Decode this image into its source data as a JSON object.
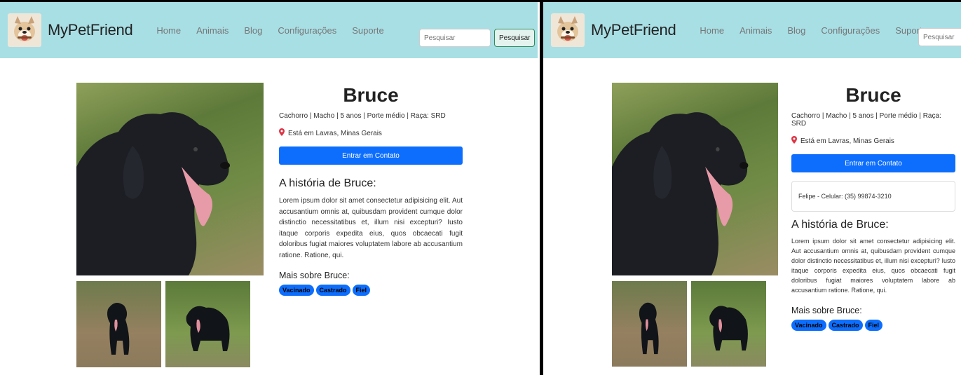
{
  "brand": "MyPetFriend",
  "nav": {
    "links": [
      "Home",
      "Animais",
      "Blog",
      "Configurações",
      "Suporte"
    ]
  },
  "search": {
    "placeholder": "Pesquisar",
    "button_label": "Pesquisar"
  },
  "pet": {
    "name": "Bruce",
    "meta": "Cachorro | Macho | 5 anos | Porte médio | Raça: SRD",
    "location": "Está em Lavras, Minas Gerais",
    "contact_button": "Entrar em Contato",
    "contact_info": "Felipe - Celular: (35) 99874-3210",
    "story_title": "A história de Bruce:",
    "story_text": "Lorem ipsum dolor sit amet consectetur adipisicing elit. Aut accusantium omnis at, quibusdam provident cumque dolor distinctio necessitatibus et, illum nisi excepturi? Iusto itaque corporis expedita eius, quos obcaecati fugit doloribus fugiat maiores voluptatem labore ab accusantium ratione. Ratione, qui.",
    "more_title": "Mais sobre Bruce:",
    "tags": [
      "Vacinado",
      "Castrado",
      "Fiel"
    ]
  },
  "colors": {
    "navbar": "#a8dfe5",
    "primary": "#0d6efd",
    "location_pin": "#dc3545"
  },
  "icons": [
    "pet-logo-icon",
    "location-pin-icon"
  ]
}
